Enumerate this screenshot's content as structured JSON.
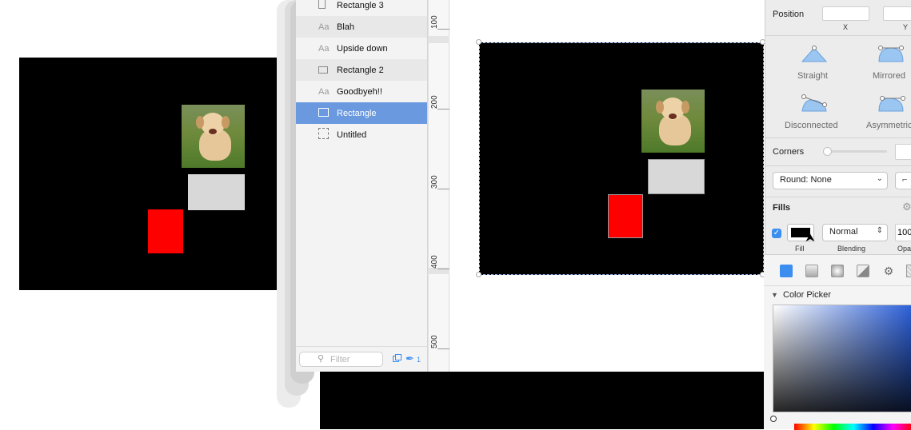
{
  "layers": {
    "items": [
      {
        "icon": "rectangle-icon",
        "label": "Rectangle 3"
      },
      {
        "icon": "text-icon",
        "icon_text": "Aa",
        "label": "Blah"
      },
      {
        "icon": "text-icon",
        "icon_text": "Aa",
        "label": "Upside down"
      },
      {
        "icon": "rectangle-icon",
        "label": "Rectangle 2"
      },
      {
        "icon": "text-icon",
        "icon_text": "Aa",
        "label": "Goodbyeh!!"
      },
      {
        "icon": "rectangle-icon",
        "label": "Rectangle",
        "selected": true
      },
      {
        "icon": "artboard-icon",
        "label": "Untitled"
      }
    ],
    "filter_placeholder": "Filter",
    "page_count": "1"
  },
  "ruler": {
    "labels": [
      "100",
      "200",
      "300",
      "400",
      "500"
    ]
  },
  "inspector": {
    "position_label": "Position",
    "x_label": "X",
    "y_label": "Y",
    "x_value": "",
    "y_value": "",
    "curve_modes": [
      "Straight",
      "Mirrored",
      "Disconnected",
      "Asymmetric"
    ],
    "corners_label": "Corners",
    "round_select": "Round: None",
    "fills_label": "Fills",
    "fill_enabled": true,
    "fill_color": "#000000",
    "blend_select": "Normal",
    "opacity_value": "100",
    "fill_sub": "Fill",
    "blending_sub": "Blending",
    "opacity_sub": "Opacity",
    "color_picker_label": "Color Picker"
  },
  "colors": {
    "selection": "#6a99e0",
    "accent": "#3b8ef0",
    "red_rect": "#ff0000",
    "gray_rect": "#d8d8d8"
  }
}
